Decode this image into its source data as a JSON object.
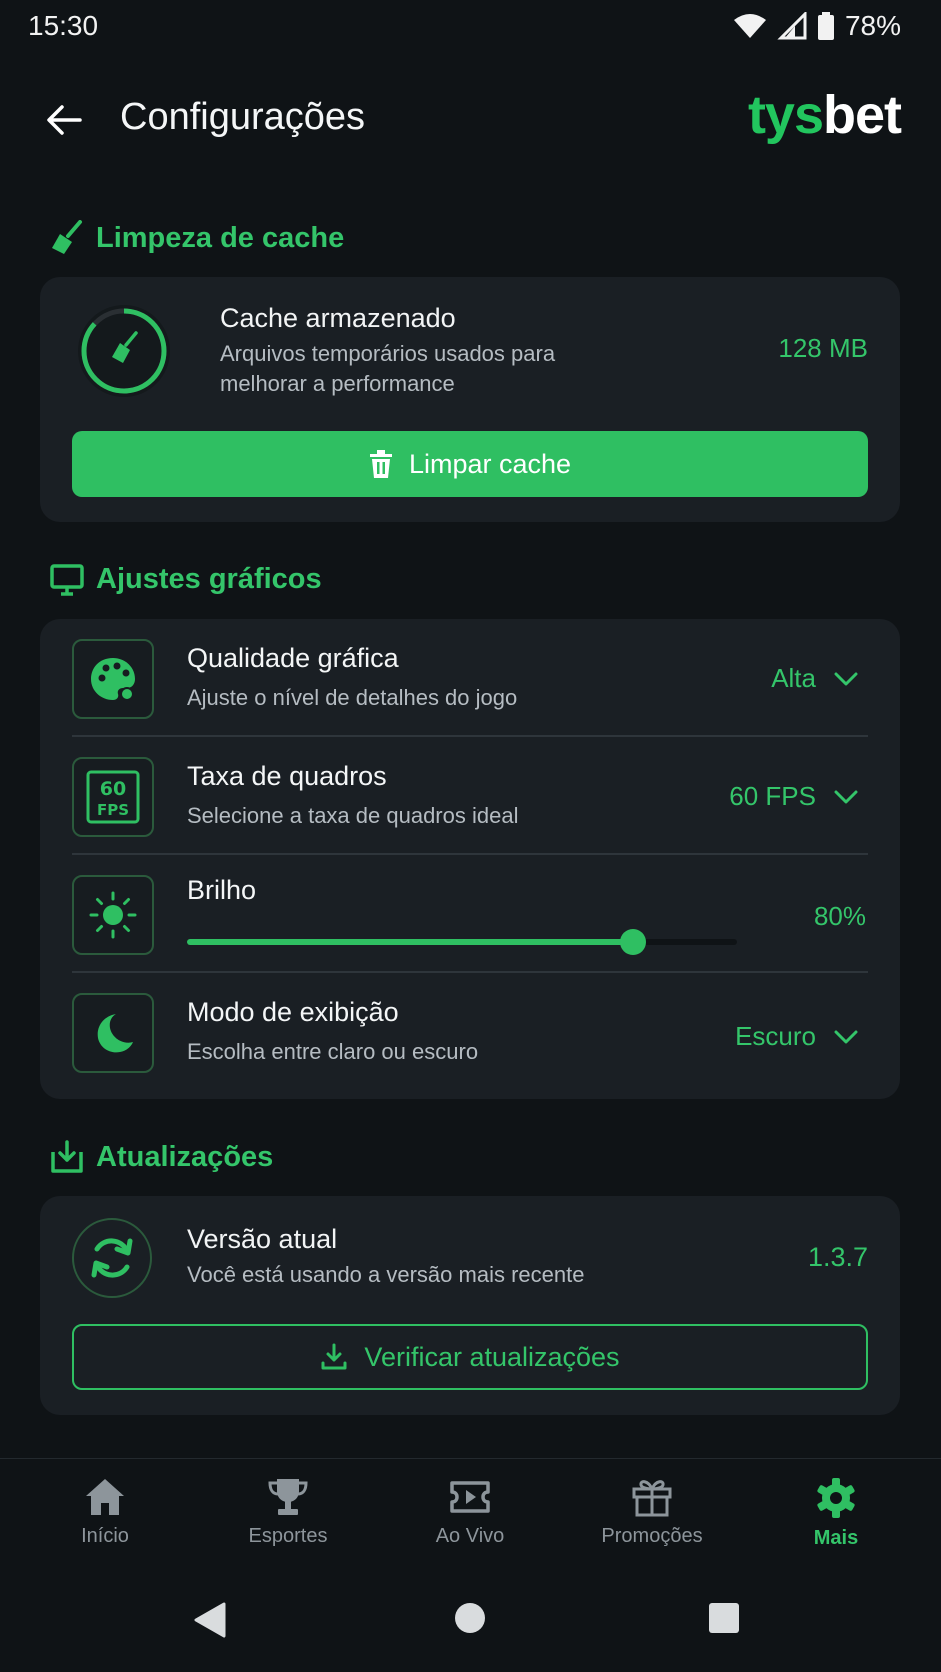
{
  "status_bar": {
    "time": "15:30",
    "battery": "78%"
  },
  "header": {
    "title": "Configurações",
    "logo_part1": "tys",
    "logo_part2": "bet"
  },
  "cache_section": {
    "title": "Limpeza de cache",
    "item_title": "Cache armazenado",
    "item_description": "Arquivos temporários usados para melhorar a performance",
    "size": "128 MB",
    "button_label": "Limpar cache"
  },
  "graphics_section": {
    "title": "Ajustes gráficos",
    "quality": {
      "title": "Qualidade gráfica",
      "subtitle": "Ajuste o nível de detalhes do jogo",
      "value": "Alta"
    },
    "framerate": {
      "title": "Taxa de quadros",
      "subtitle": "Selecione a taxa de quadros ideal",
      "value": "60 FPS",
      "icon_text_top": "60",
      "icon_text_bottom": "FPS"
    },
    "brightness": {
      "title": "Brilho",
      "value": "80%",
      "level": 0.81
    },
    "display_mode": {
      "title": "Modo de exibição",
      "subtitle": "Escolha entre claro ou escuro",
      "value": "Escuro"
    }
  },
  "updates_section": {
    "title": "Atualizações",
    "item_title": "Versão atual",
    "item_subtitle": "Você está usando a versão mais recente",
    "version": "1.3.7",
    "button_label": "Verificar atualizações"
  },
  "bottom_nav": {
    "items": [
      {
        "label": "Início",
        "icon": "home-icon"
      },
      {
        "label": "Esportes",
        "icon": "trophy-icon"
      },
      {
        "label": "Ao Vivo",
        "icon": "live-ticket-icon"
      },
      {
        "label": "Promoções",
        "icon": "gift-icon"
      },
      {
        "label": "Mais",
        "icon": "gear-icon"
      }
    ],
    "active_index": 4
  },
  "colors": {
    "accent": "#2fbf62",
    "background": "#0f1316",
    "card": "#1a1f24"
  }
}
